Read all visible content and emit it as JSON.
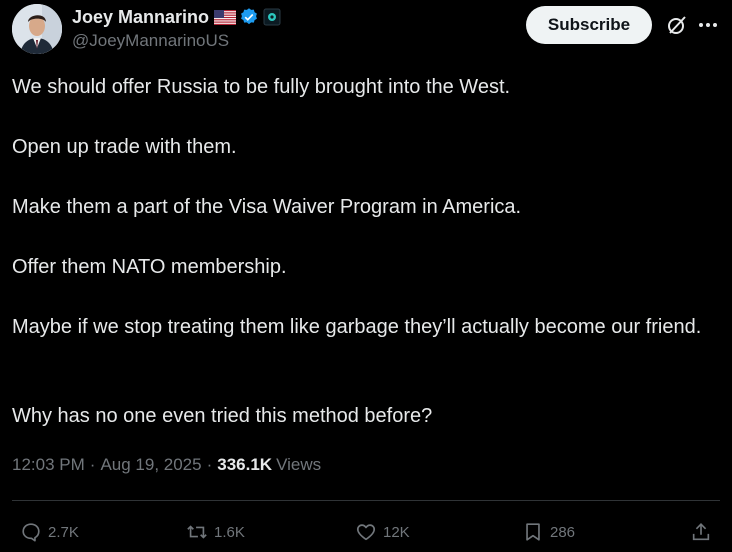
{
  "author": {
    "display_name": "Joey Mannarino",
    "handle": "@JoeyMannarinoUS"
  },
  "header": {
    "subscribe_label": "Subscribe"
  },
  "tweet": {
    "paragraphs": [
      "We should offer Russia to be fully brought into the West.",
      "Open up trade with them.",
      "Make them a part of the Visa Waiver Program in America.",
      "Offer them NATO membership.",
      "Maybe if we stop treating them like garbage they’ll actually become our friend.",
      "Why has no one even tried this method before?"
    ]
  },
  "meta": {
    "time": "12:03 PM",
    "date": "Aug 19, 2025",
    "separator": "·",
    "views_count": "336.1K",
    "views_label": "Views"
  },
  "actions": {
    "replies": "2.7K",
    "reposts": "1.6K",
    "likes": "12K",
    "bookmarks": "286"
  },
  "colors": {
    "background": "#000000",
    "text": "#e7e9ea",
    "muted": "#71767b",
    "verified": "#1d9bf0",
    "divider": "#2f3336"
  }
}
